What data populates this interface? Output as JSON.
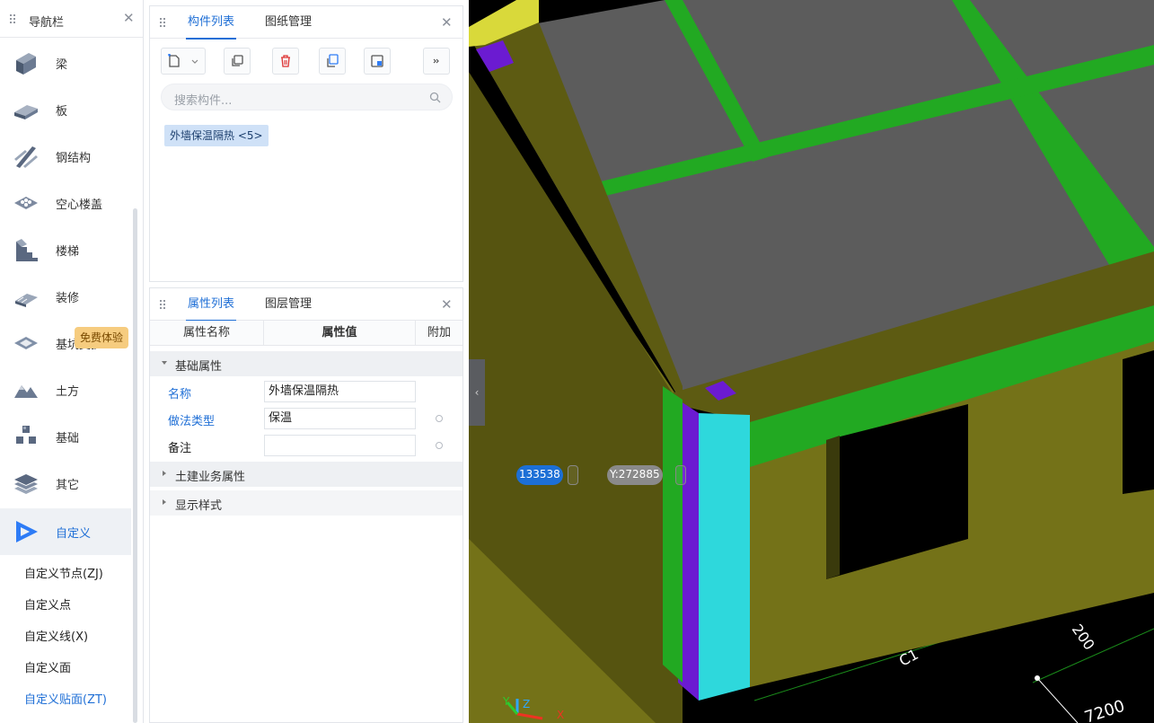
{
  "nav": {
    "title": "导航栏",
    "items": [
      {
        "label": "梁",
        "icon": "beam-icon"
      },
      {
        "label": "板",
        "icon": "slab-icon"
      },
      {
        "label": "钢结构",
        "icon": "steel-structure-icon"
      },
      {
        "label": "空心楼盖",
        "icon": "hollow-floor-icon"
      },
      {
        "label": "楼梯",
        "icon": "stairs-icon"
      },
      {
        "label": "装修",
        "icon": "decoration-icon"
      },
      {
        "label": "基坑支护",
        "icon": "foundation-pit-icon"
      },
      {
        "label": "土方",
        "icon": "earthwork-icon"
      },
      {
        "label": "基础",
        "icon": "foundation-icon"
      },
      {
        "label": "其它",
        "icon": "other-icon"
      },
      {
        "label": "自定义",
        "icon": "custom-icon"
      }
    ],
    "subitems": [
      "自定义节点(ZJ)",
      "自定义点",
      "自定义线(X)",
      "自定义面",
      "自定义贴面(ZT)"
    ],
    "trial_badge": "免费体验"
  },
  "component_panel": {
    "tabs": [
      "构件列表",
      "图纸管理"
    ],
    "search_placeholder": "搜索构件...",
    "items": [
      {
        "label": "外墙保温隔热 <5>"
      }
    ]
  },
  "property_panel": {
    "tabs": [
      "属性列表",
      "图层管理"
    ],
    "columns": [
      "属性名称",
      "属性值",
      "附加"
    ],
    "groups": {
      "basic": "基础属性",
      "civil": "土建业务属性",
      "display": "显示样式"
    },
    "rows": [
      {
        "name": "名称",
        "value": "外墙保温隔热"
      },
      {
        "name": "做法类型",
        "value": "保温"
      },
      {
        "name": "备注",
        "value": ""
      }
    ]
  },
  "viewport": {
    "coord_x": "133538",
    "coord_y": "Y:272885",
    "labels": {
      "c1": "C1",
      "dim_200": "200",
      "dim_7200": "7200"
    },
    "colors": {
      "wall": "#747218",
      "roof_slab": "#5c5c5c",
      "beam_green": "#22a922",
      "insulation_cyan": "#2ed8dc",
      "insulation_purple": "#6b1bd1"
    }
  }
}
